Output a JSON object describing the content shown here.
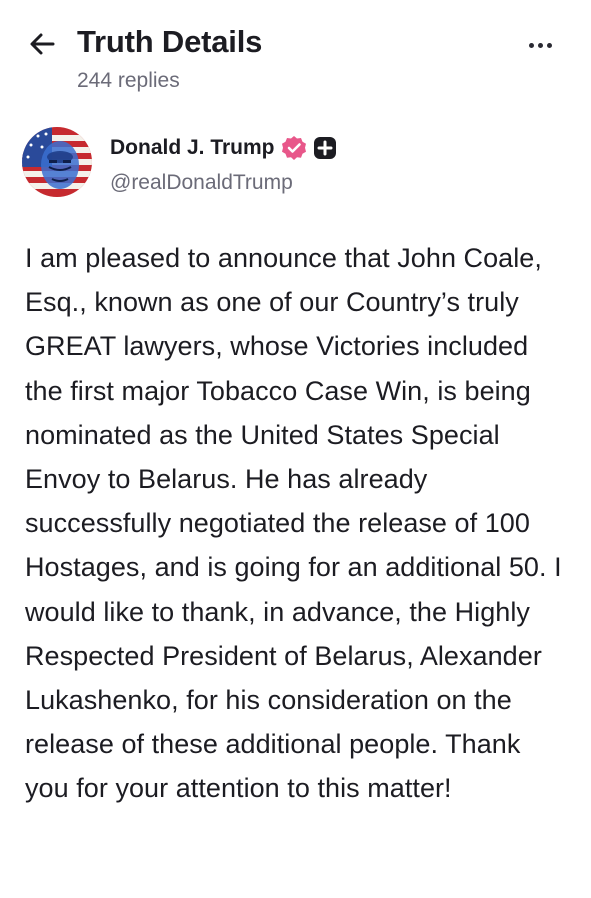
{
  "header": {
    "back_icon": "arrow-left-icon",
    "title": "Truth Details",
    "replies": "244 replies",
    "more_icon": "more-horizontal-icon"
  },
  "author": {
    "name": "Donald J. Trump",
    "handle": "@realDonaldTrump",
    "verified_icon": "verified-badge-icon",
    "plus_icon": "truth-plus-icon",
    "badge_color": "#e8578a"
  },
  "post": {
    "text": "I am pleased to announce that John Coale, Esq., known as one of our Country’s truly GREAT lawyers, whose Victories included the first major Tobacco Case Win, is being nominated as the United States Special Envoy to Belarus. He has already successfully negotiated the release of 100 Hostages, and is going for an additional 50. I would like to thank, in advance, the Highly Respected President of Belarus, Alexander Lukashenko, for his consideration on the release of these additional people. Thank you for your attention to this matter!"
  }
}
